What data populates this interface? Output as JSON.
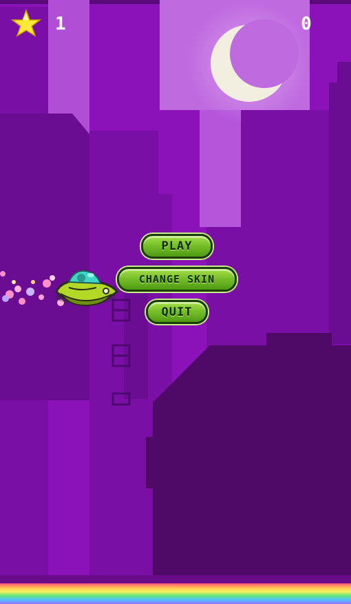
{
  "hud": {
    "star_icon": "star-icon",
    "stars_collected": "1",
    "score": "0"
  },
  "menu": {
    "play_label": "PLAY",
    "change_skin_label": "CHANGE SKIN",
    "quit_label": "QUIT"
  },
  "colors": {
    "sky": "#8a12b8",
    "buildings_light": "#7a0fa6",
    "buildings_dark": "#4a0a5e",
    "button_green": "#78c02a",
    "ufo_body": "#b3d826",
    "ufo_dome": "#3fd6c8"
  }
}
